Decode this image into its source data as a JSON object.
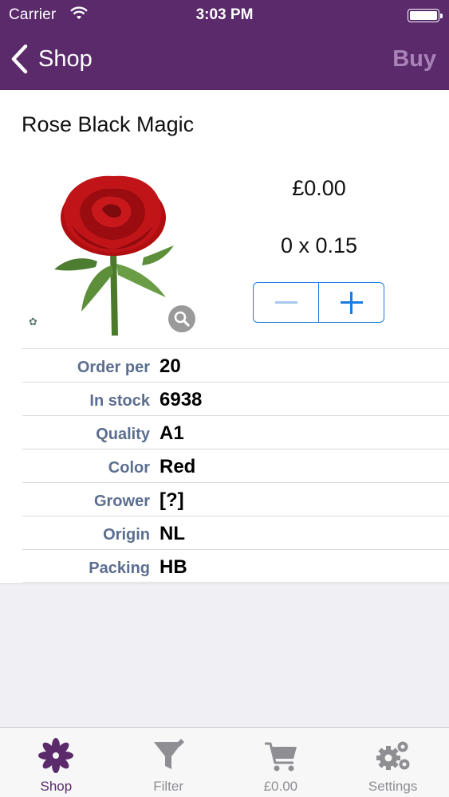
{
  "status": {
    "carrier": "Carrier",
    "time": "3:03 PM"
  },
  "nav": {
    "back_label": "Shop",
    "buy_label": "Buy"
  },
  "product": {
    "title": "Rose Black Magic",
    "price": "£0.00",
    "quantity_text": "0 x 0.15",
    "details": [
      {
        "key": "Order per",
        "value": "20"
      },
      {
        "key": "In stock",
        "value": "6938"
      },
      {
        "key": "Quality",
        "value": "A1"
      },
      {
        "key": "Color",
        "value": "Red"
      },
      {
        "key": "Grower",
        "value": "[?]"
      },
      {
        "key": "Origin",
        "value": "NL"
      },
      {
        "key": "Packing",
        "value": "HB"
      }
    ]
  },
  "tabs": [
    {
      "label": "Shop",
      "icon": "flower-icon",
      "active": true
    },
    {
      "label": "Filter",
      "icon": "funnel-icon",
      "active": false
    },
    {
      "label": "£0.00",
      "icon": "cart-icon",
      "active": false
    },
    {
      "label": "Settings",
      "icon": "gears-icon",
      "active": false
    }
  ],
  "colors": {
    "nav_bg": "#5a2a6b",
    "accent_blue": "#1a7de0",
    "detail_key": "#5b6e8f"
  }
}
